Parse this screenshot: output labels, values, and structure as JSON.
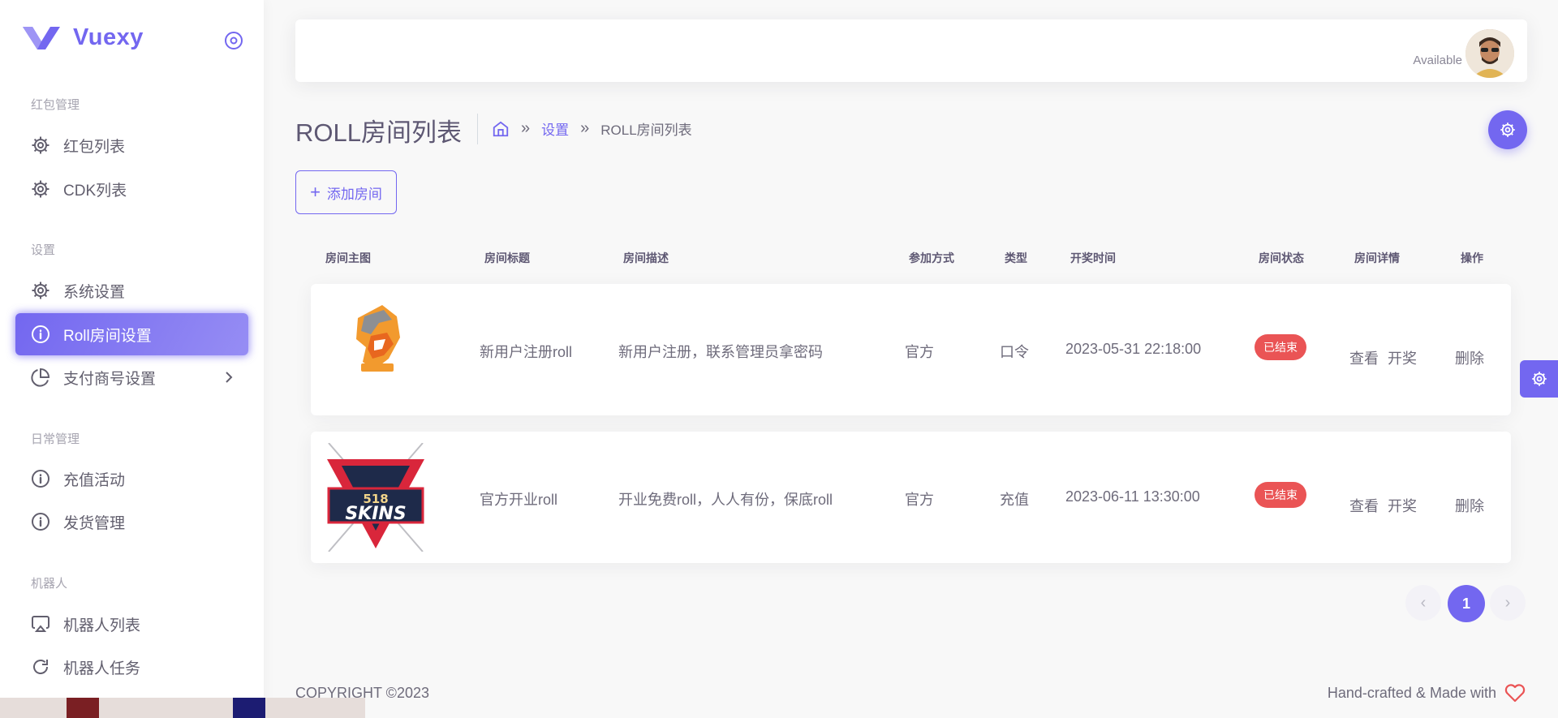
{
  "brand": {
    "name": "Vuexy"
  },
  "sidebar": {
    "sections": [
      {
        "header": "红包管理",
        "items": [
          {
            "label": "红包列表",
            "icon": "gear-icon"
          },
          {
            "label": "CDK列表",
            "icon": "gear-icon"
          }
        ]
      },
      {
        "header": "设置",
        "items": [
          {
            "label": "系统设置",
            "icon": "gear-icon"
          },
          {
            "label": "Roll房间设置",
            "icon": "info-icon",
            "active": true
          },
          {
            "label": "支付商号设置",
            "icon": "pie-chart-icon",
            "has_submenu": true
          }
        ]
      },
      {
        "header": "日常管理",
        "items": [
          {
            "label": "充值活动",
            "icon": "info-icon"
          },
          {
            "label": "发货管理",
            "icon": "info-icon"
          }
        ]
      },
      {
        "header": "机器人",
        "items": [
          {
            "label": "机器人列表",
            "icon": "airplay-icon"
          },
          {
            "label": "机器人任务",
            "icon": "refresh-icon"
          }
        ]
      }
    ]
  },
  "navbar": {
    "user_status": "Available"
  },
  "page": {
    "title": "ROLL房间列表",
    "breadcrumb": {
      "link": "设置",
      "current": "ROLL房间列表"
    },
    "add_button": "添加房间"
  },
  "table": {
    "headers": [
      "房间主图",
      "房间标题",
      "房间描述",
      "参加方式",
      "类型",
      "开奖时间",
      "房间状态",
      "房间详情",
      "操作"
    ],
    "rows": [
      {
        "title": "新用户注册roll",
        "description": "新用户注册，联系管理员拿密码",
        "join": "官方",
        "type": "口令",
        "draw_time": "2023-05-31 22:18:00",
        "status": "已结束",
        "view": "查看",
        "draw": "开奖",
        "delete": "删除"
      },
      {
        "title": "官方开业roll",
        "description": "开业免费roll，人人有份，保底roll",
        "join": "官方",
        "type": "充值",
        "draw_time": "2023-06-11 13:30:00",
        "status": "已结束",
        "view": "查看",
        "draw": "开奖",
        "delete": "删除",
        "image_text": {
          "number": "518",
          "word": "SKINS"
        }
      }
    ]
  },
  "pagination": {
    "current": "1",
    "prev": "‹",
    "next": "›"
  },
  "footer": {
    "left": "COPYRIGHT ©2023",
    "right": "Hand-crafted & Made with"
  },
  "colors": {
    "primary": "#7367f0",
    "danger": "#ea5455"
  }
}
